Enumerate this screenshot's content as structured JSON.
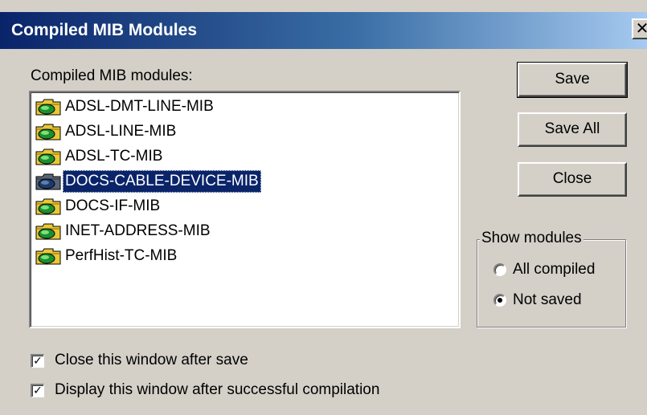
{
  "window": {
    "title": "Compiled MIB Modules",
    "close_glyph": "✕"
  },
  "list": {
    "label": "Compiled MIB modules:",
    "items": [
      {
        "label": "ADSL-DMT-LINE-MIB",
        "icon": "mib-folder-icon",
        "selected": false
      },
      {
        "label": "ADSL-LINE-MIB",
        "icon": "mib-folder-icon",
        "selected": false
      },
      {
        "label": "ADSL-TC-MIB",
        "icon": "mib-folder-icon",
        "selected": false
      },
      {
        "label": "DOCS-CABLE-DEVICE-MIB",
        "icon": "mib-folder-icon",
        "selected": true
      },
      {
        "label": "DOCS-IF-MIB",
        "icon": "mib-folder-icon",
        "selected": false
      },
      {
        "label": "INET-ADDRESS-MIB",
        "icon": "mib-folder-icon",
        "selected": false
      },
      {
        "label": "PerfHist-TC-MIB",
        "icon": "mib-folder-icon",
        "selected": false
      }
    ]
  },
  "buttons": {
    "save": "Save",
    "save_all": "Save All",
    "close": "Close"
  },
  "show_modules": {
    "legend": "Show modules",
    "options": [
      {
        "label": "All compiled",
        "selected": false
      },
      {
        "label": "Not saved",
        "selected": true
      }
    ]
  },
  "options": {
    "close_after_save": {
      "label": "Close this window after save",
      "checked": true,
      "mark": "✓"
    },
    "display_after_compile": {
      "label": "Display this window after successful compilation",
      "checked": true,
      "mark": "✓"
    }
  },
  "colors": {
    "selection": "#0a246a",
    "titlebar_start": "#0a246a",
    "titlebar_end": "#a6caf0",
    "face": "#d4d0c8"
  }
}
